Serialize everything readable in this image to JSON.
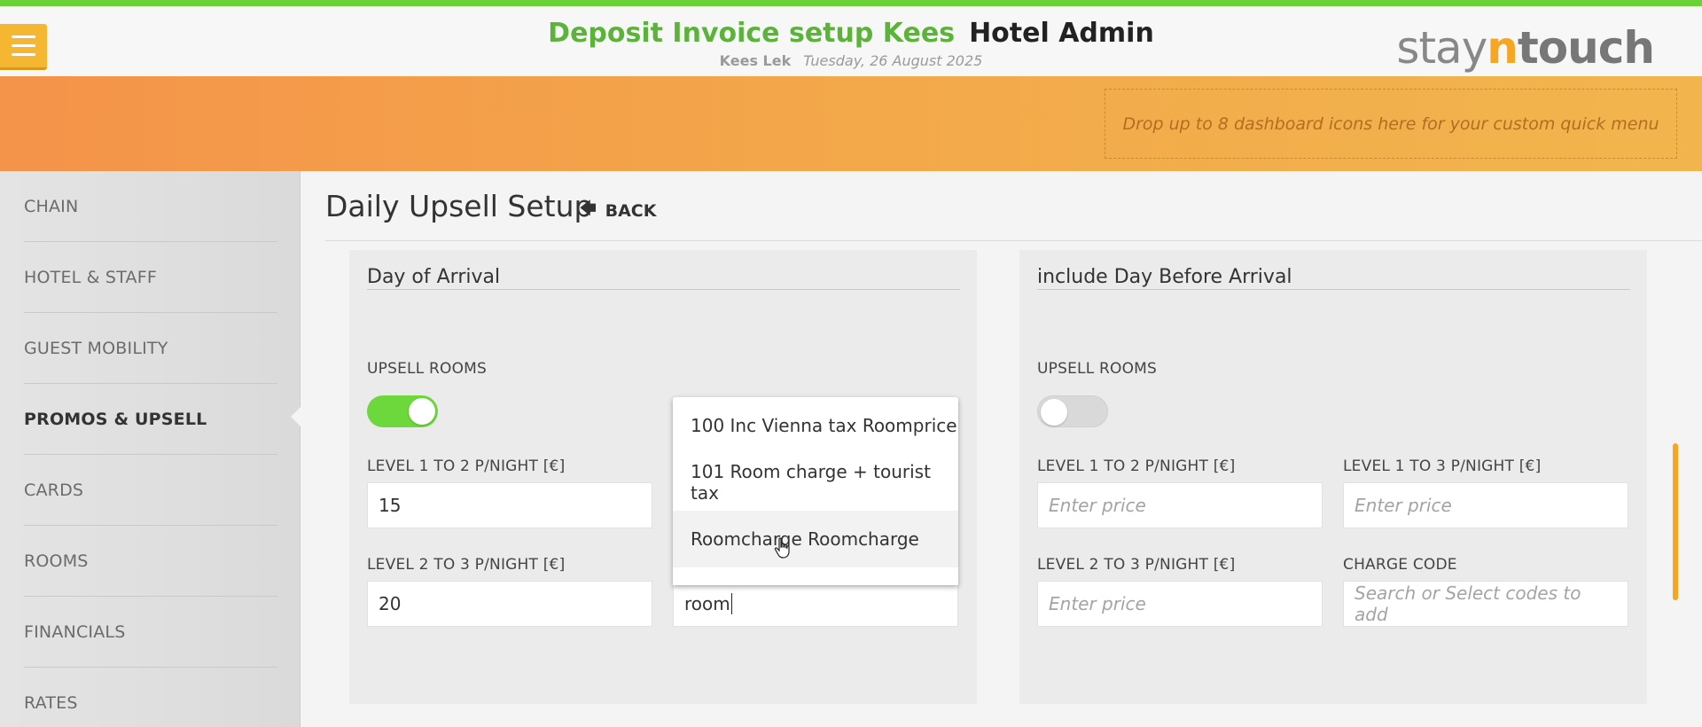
{
  "header": {
    "hotel_name": "Deposit Invoice setup Kees",
    "app_name": "Hotel Admin",
    "user_name": "Kees Lek",
    "date": "Tuesday, 26 August 2025",
    "logo_prefix": "stay",
    "logo_n": "n",
    "logo_suffix": "touch",
    "menu_icon": "hamburger-icon"
  },
  "quick_menu": {
    "placeholder": "Drop up to 8 dashboard icons here for your custom quick menu"
  },
  "sidebar": {
    "items": [
      {
        "label": "CHAIN"
      },
      {
        "label": "HOTEL & STAFF"
      },
      {
        "label": "GUEST MOBILITY"
      },
      {
        "label": "PROMOS & UPSELL"
      },
      {
        "label": "CARDS"
      },
      {
        "label": "ROOMS"
      },
      {
        "label": "FINANCIALS"
      },
      {
        "label": "RATES"
      }
    ],
    "active": "PROMOS & UPSELL"
  },
  "page": {
    "title": "Daily Upsell Setup",
    "back_label": "BACK"
  },
  "left_panel": {
    "title": "Day of Arrival",
    "upsell_rooms_label": "UPSELL ROOMS",
    "upsell_rooms_enabled": true,
    "level_1_2_label": "LEVEL 1 TO 2 P/NIGHT [€]",
    "level_1_2_value": "15",
    "level_2_3_label": "LEVEL 2 TO 3 P/NIGHT [€]",
    "level_2_3_value": "20",
    "charge_code_input": "room",
    "dropdown_options": [
      "100 Inc Vienna tax Roomprice",
      "101 Room charge + tourist tax",
      "Roomcharge Roomcharge"
    ],
    "hovered_option": "Roomcharge Roomcharge"
  },
  "right_panel": {
    "title": "include Day Before Arrival",
    "upsell_rooms_label": "UPSELL ROOMS",
    "upsell_rooms_enabled": false,
    "level_1_2_label": "LEVEL 1 TO 2 P/NIGHT [€]",
    "level_1_2_placeholder": "Enter price",
    "level_1_3_label": "LEVEL 1 TO 3 P/NIGHT [€]",
    "level_1_3_placeholder": "Enter price",
    "level_2_3_label": "LEVEL 2 TO 3 P/NIGHT [€]",
    "level_2_3_placeholder": "Enter price",
    "charge_code_label": "CHARGE CODE",
    "charge_code_placeholder": "Search or Select codes to add"
  },
  "colors": {
    "accent_green": "#6cd038",
    "toggle_on": "#6cd83b",
    "band_orange": "#f4934a",
    "menu_yellow": "#f5b731"
  }
}
